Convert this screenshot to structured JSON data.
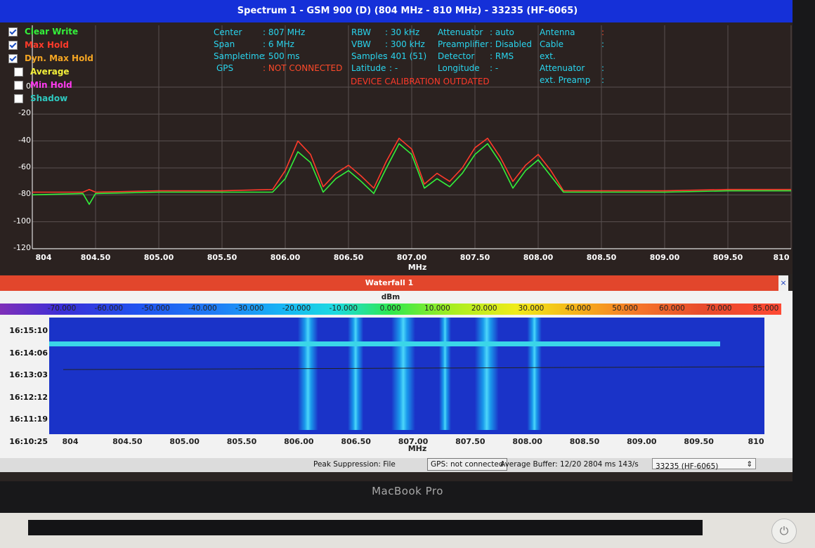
{
  "spectrum": {
    "title": "Spectrum 1 - GSM 900 (D) (804 MHz - 810 MHz) - 33235 (HF-6065)",
    "legend": [
      {
        "label": "Clear Write",
        "color": "#33f03a",
        "checked": true
      },
      {
        "label": "Max Hold",
        "color": "#ff3a2a",
        "checked": true
      },
      {
        "label": "Dyn. Max Hold",
        "color": "#f5a623",
        "checked": true
      },
      {
        "label": "Average",
        "color": "#f3f03a",
        "checked": false
      },
      {
        "label": "Min Hold",
        "color": "#ff3af0",
        "checked": false
      },
      {
        "label": "Shadow",
        "color": "#2ec9c0",
        "checked": false
      }
    ],
    "info": {
      "center_k": "Center",
      "center_v": ": 807 MHz",
      "span_k": "Span",
      "span_v": ": 6 MHz",
      "sampletime_k": "Sampletime",
      "sampletime_v": ": 500 ms",
      "gps_k": "GPS",
      "gps_v": ": NOT CONNECTED",
      "rbw_k": "RBW",
      "rbw_v": ": 30 kHz",
      "vbw_k": "VBW",
      "vbw_v": ": 300 kHz",
      "samples_k": "Samples",
      "samples_v": ": 401 (51)",
      "latitude_k": "Latitude",
      "latitude_v": ": -",
      "attenuator_k": "Attenuator",
      "attenuator_v": ": auto",
      "preamplifier_k": "Preamplifier",
      "preamplifier_v": ": Disabled",
      "detector_k": "Detector",
      "detector_v": ": RMS",
      "longitude_k": "Longitude",
      "longitude_v": ": -",
      "antenna_k": "Antenna",
      "antenna_v": ":",
      "cable_k": "Cable",
      "cable_v": ":",
      "ext_att_k": "ext. Attenuator",
      "ext_att_v": ":",
      "ext_pre_k": "ext. Preamp",
      "ext_pre_v": ":",
      "warning": "DEVICE CALIBRATION OUTDATED"
    },
    "x_unit": "MHz",
    "chart_data": {
      "type": "line",
      "xlim": [
        804,
        810
      ],
      "ylim": [
        -120,
        0
      ],
      "y_ticks": [
        "0",
        "-20",
        "-40",
        "-60",
        "-80",
        "-100",
        "-120"
      ],
      "x_ticks": [
        "804",
        "804.50",
        "805.00",
        "805.50",
        "806.00",
        "806.50",
        "807.00",
        "807.50",
        "808.00",
        "808.50",
        "809.00",
        "809.50",
        "810"
      ],
      "series": [
        {
          "color": "#ff3a2a",
          "x": [
            804,
            804.4,
            804.45,
            804.5,
            805.0,
            805.5,
            805.9,
            806.0,
            806.1,
            806.2,
            806.3,
            806.4,
            806.5,
            806.6,
            806.7,
            806.8,
            806.9,
            807.0,
            807.1,
            807.2,
            807.3,
            807.4,
            807.5,
            807.6,
            807.7,
            807.8,
            807.9,
            808.0,
            808.1,
            808.2,
            808.5,
            809.0,
            809.5,
            810
          ],
          "y": [
            -78,
            -78,
            -76,
            -78,
            -77,
            -77,
            -76,
            -62,
            -40,
            -50,
            -74,
            -64,
            -58,
            -66,
            -75,
            -55,
            -38,
            -46,
            -72,
            -64,
            -70,
            -60,
            -45,
            -38,
            -52,
            -70,
            -58,
            -50,
            -62,
            -77,
            -77,
            -77,
            -76,
            -76
          ]
        },
        {
          "color": "#33f03a",
          "x": [
            804,
            804.4,
            804.45,
            804.5,
            805.0,
            805.5,
            805.9,
            806.0,
            806.1,
            806.2,
            806.3,
            806.4,
            806.5,
            806.6,
            806.7,
            806.8,
            806.9,
            807.0,
            807.1,
            807.2,
            807.3,
            807.4,
            807.5,
            807.6,
            807.7,
            807.8,
            807.9,
            808.0,
            808.1,
            808.2,
            808.5,
            809.0,
            809.5,
            810
          ],
          "y": [
            -80,
            -79,
            -87,
            -79,
            -78,
            -78,
            -78,
            -68,
            -48,
            -56,
            -78,
            -68,
            -62,
            -70,
            -79,
            -60,
            -42,
            -50,
            -75,
            -68,
            -74,
            -64,
            -50,
            -42,
            -56,
            -75,
            -62,
            -54,
            -66,
            -78,
            -78,
            -78,
            -77,
            -77
          ]
        }
      ]
    }
  },
  "waterfall": {
    "title": "Waterfall 1",
    "close": "×",
    "unit": "dBm",
    "colorbar_labels": [
      "-70.000",
      "-60.000",
      "-50.000",
      "-40.000",
      "-30.000",
      "-20.000",
      "-10.000",
      "0.000",
      "10.000",
      "20.000",
      "30.000",
      "40.000",
      "50.000",
      "60.000",
      "70.000",
      "85.000"
    ],
    "times": [
      "16:15:10",
      "16:14:06",
      "16:13:03",
      "16:12:12",
      "16:11:19",
      "16:10:25"
    ],
    "x_ticks": [
      "804",
      "804.50",
      "805.00",
      "805.50",
      "806.00",
      "806.50",
      "807.00",
      "807.50",
      "808.00",
      "808.50",
      "809.00",
      "809.50",
      "810"
    ],
    "x_unit": "MHz"
  },
  "status": {
    "peak": "Peak Suppression: File",
    "gps": "GPS: not connected",
    "buffer": "Average Buffer: 12/20  2804 ms   143/s",
    "device": "33235 (HF-6065)"
  },
  "laptop": {
    "brand": "MacBook Pro"
  }
}
